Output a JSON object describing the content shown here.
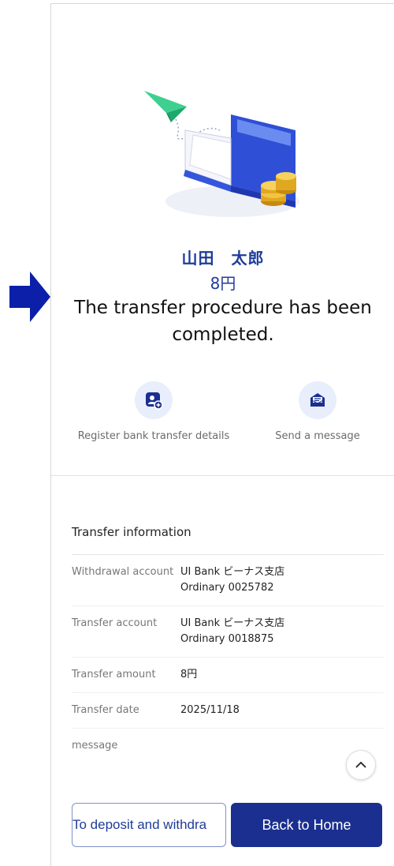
{
  "recipient": {
    "name": "山田　太郎",
    "amount": "8円"
  },
  "status_message": "The transfer procedure has been completed.",
  "actions": {
    "register_label": "Register bank transfer details",
    "message_label": "Send a message"
  },
  "transfer_info": {
    "title": "Transfer information",
    "rows": [
      {
        "label": "Withdrawal account",
        "value_line1": "UI Bank ビーナス支店",
        "value_line2": "Ordinary 0025782"
      },
      {
        "label": "Transfer account",
        "value_line1": "UI Bank ビーナス支店",
        "value_line2": "Ordinary 0018875"
      },
      {
        "label": "Transfer amount",
        "value_line1": "8円"
      },
      {
        "label": "Transfer date",
        "value_line1": "2025/11/18"
      },
      {
        "label": "message",
        "value_line1": ""
      }
    ]
  },
  "buttons": {
    "deposit_label": "To deposit and withdra",
    "home_label": "Back to Home"
  },
  "colors": {
    "brand_blue": "#1a2f8f",
    "accent_blue": "#1f3c9a",
    "arrow_blue": "#0b1fa8",
    "icon_bg": "#e8eefc"
  },
  "icons": {
    "arrow": "right-arrow-icon",
    "register": "contact-add-icon",
    "message": "envelope-icon",
    "scroll": "chevron-up-icon"
  }
}
